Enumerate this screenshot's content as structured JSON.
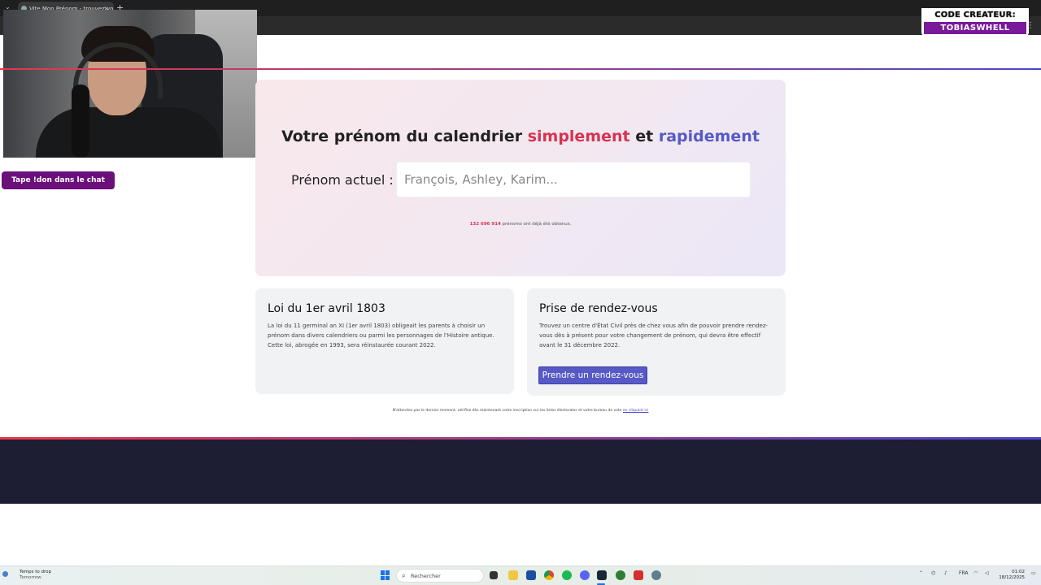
{
  "browser": {
    "tab_title": "Vite Mon Prénom - trouvez vo",
    "close_glyph": "×",
    "new_tab_glyph": "+",
    "menu_glyph": "⋮"
  },
  "stream": {
    "don_label": "Tape !don dans le chat",
    "creator_line1": "CODE CREATEUR:",
    "creator_line2": "TOBIASWHELL"
  },
  "hero": {
    "title_prefix": "Votre prénom du calendrier",
    "title_word_red": "simplement",
    "title_and": "et",
    "title_word_blue": "rapidement",
    "field_label": "Prénom actuel :",
    "field_placeholder": "François, Ashley, Karim...",
    "counter_number": "132 696 914",
    "counter_text": "prénoms ont déjà été obtenus."
  },
  "cards": {
    "law_title": "Loi du 1er avril 1803",
    "law_text": "La loi du 11 germinal an XI (1er avril 1803) obligeait les parents à choisir un prénom dans divers calendriers ou parmi les personnages de l'Histoire antique. Cette loi, abrogée en 1993, sera réinstaurée courant 2022.",
    "rdv_title": "Prise de rendez-vous",
    "rdv_text": "Trouvez un centre d'État Civil près de chez vous afin de pouvoir prendre rendez-vous dès à présent pour votre changement de prénom, qui devra être effectif avant le 31 décembre 2022.",
    "rdv_button": "Prendre un rendez-vous"
  },
  "footnote": {
    "text": "N'attendez pas le dernier moment, vérifiez dès maintenant votre inscription sur les listes électorales et votre bureau de vote",
    "link": "en cliquant ici"
  },
  "taskbar": {
    "weather_title": "Temps to drop",
    "weather_sub": "Tomorrow",
    "search_placeholder": "Rechercher",
    "lang": "FRA",
    "time": "01:02",
    "date": "18/12/2025"
  },
  "colors": {
    "accent_red": "#d83352",
    "accent_blue": "#5659c6",
    "footer": "#1d1e33"
  }
}
